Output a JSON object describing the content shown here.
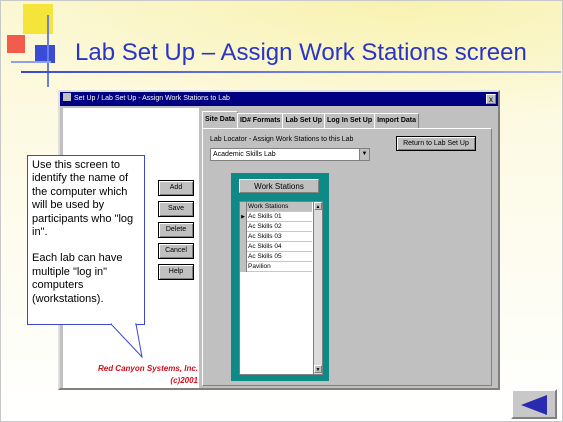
{
  "slide": {
    "title": "Lab Set Up – Assign Work Stations screen"
  },
  "window": {
    "title": "Set Up / Lab Set Up - Assign Work Stations to Lab",
    "close_label": "x",
    "tabs": [
      {
        "label": "Site Data",
        "active": true
      },
      {
        "label": "ID# Formats",
        "active": false
      },
      {
        "label": "Lab Set Up",
        "active": false
      },
      {
        "label": "Log In Set Up",
        "active": false
      },
      {
        "label": "Import Data",
        "active": false
      }
    ],
    "locator_label": "Lab Locator - Assign Work Stations to this Lab",
    "locator_value": "Academic Skills Lab",
    "return_button": "Return to Lab Set Up",
    "buttons": {
      "add": "Add",
      "save": "Save",
      "delete": "Delete",
      "cancel": "Cancel",
      "help": "Help"
    },
    "workstations_header": "Work Stations",
    "grid_column": "Work Stations",
    "workstations": [
      "Ac Skills 01",
      "Ac Skills 02",
      "Ac Skills 03",
      "Ac Skills 04",
      "Ac Skills 05",
      "Pavilion"
    ],
    "company": "Red Canyon Systems, Inc.",
    "copyright": "(c)2001"
  },
  "callout": {
    "para1": "Use this screen to identify the name of the computer which will be used by participants who \"log in\".",
    "para2": "Each lab can have multiple \"log in\" computers (workstations)."
  },
  "colors": {
    "title": "#2a35c7",
    "titlebar": "#000080",
    "teal": "#0e8a86",
    "company": "#d0101c",
    "nav_arrow": "#2a2ab0"
  },
  "icons": {
    "back": "back-arrow-icon"
  }
}
